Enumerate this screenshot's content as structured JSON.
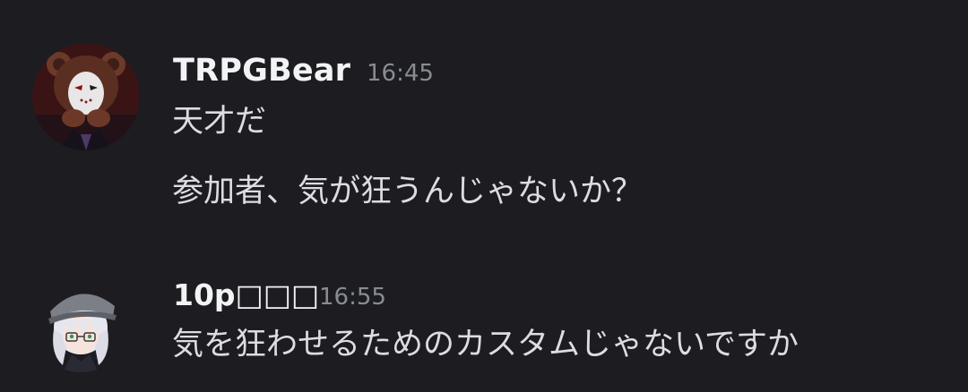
{
  "messages": [
    {
      "username": "TRPGBear",
      "timestamp": "16:45",
      "avatar_icon": "bear-mask-avatar-icon",
      "lines": [
        "天才だ",
        "参加者、気が狂うんじゃないか？"
      ]
    },
    {
      "username": "10p□□□",
      "timestamp": "16:55",
      "avatar_icon": "cap-glasses-character-avatar-icon",
      "lines": [
        "気を狂わせるためのカスタムじゃないですか"
      ]
    }
  ],
  "colors": {
    "background": "#1c1c21",
    "username": "#f2f3f5",
    "timestamp": "#8a8c94",
    "message_text": "#dcdde0"
  }
}
